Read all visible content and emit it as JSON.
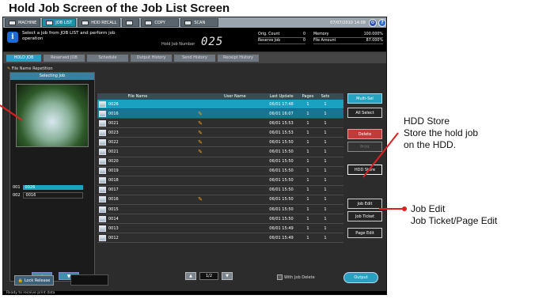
{
  "heading": "Hold Job Screen of the Job List Screen",
  "tabs": [
    {
      "label": "MACHINE",
      "active": false
    },
    {
      "label": "JOB LIST",
      "active": true
    },
    {
      "label": "HDD RECALL",
      "active": false
    },
    {
      "label": "",
      "active": false
    },
    {
      "label": "COPY",
      "active": false
    },
    {
      "label": "SCAN",
      "active": false
    }
  ],
  "datetime": "07/07/2010 14:08",
  "info": {
    "message": "Select a job from JOB LIST and perform job operation",
    "hold_label": "Hold Job Number",
    "hold_number": "025",
    "stats_left": [
      {
        "k": "Orig. Count",
        "v": "0"
      },
      {
        "k": "Reserve Job",
        "v": "0"
      }
    ],
    "stats_right": [
      {
        "k": "Memory",
        "v": "100.000%"
      },
      {
        "k": "File Amount",
        "v": "87.000%"
      }
    ]
  },
  "subtabs": [
    "HOLD JOB",
    "Reserved JOB",
    "Schedule",
    "Output History",
    "Send History",
    "Receipt History"
  ],
  "file_name_repetition": "File Name Repetition",
  "left_panel": {
    "header": "Selecting Job",
    "selected": [
      {
        "no": "001",
        "name": "0026"
      },
      {
        "no": "002",
        "name": "0016"
      }
    ]
  },
  "table": {
    "headers": {
      "file_name": "File Name",
      "user_name": "User Name",
      "last_update": "Last Update",
      "pages": "Pages",
      "sets": "Sets"
    },
    "rows": [
      {
        "name": "0026",
        "edit": "",
        "date": "06/01 17:48",
        "pages": "1",
        "sets": "1",
        "state": "sel"
      },
      {
        "name": "0016",
        "edit": "✎",
        "date": "06/01 16:07",
        "pages": "1",
        "sets": "1",
        "state": "sel2"
      },
      {
        "name": "0021",
        "edit": "✎",
        "date": "06/01 15:53",
        "pages": "1",
        "sets": "1",
        "state": ""
      },
      {
        "name": "0023",
        "edit": "✎",
        "date": "06/01 15:53",
        "pages": "1",
        "sets": "1",
        "state": ""
      },
      {
        "name": "0022",
        "edit": "✎",
        "date": "06/01 15:50",
        "pages": "1",
        "sets": "1",
        "state": ""
      },
      {
        "name": "0021",
        "edit": "✎",
        "date": "06/01 15:50",
        "pages": "1",
        "sets": "1",
        "state": ""
      },
      {
        "name": "0020",
        "edit": "",
        "date": "06/01 15:50",
        "pages": "1",
        "sets": "1",
        "state": ""
      },
      {
        "name": "0019",
        "edit": "",
        "date": "06/01 15:50",
        "pages": "1",
        "sets": "1",
        "state": ""
      },
      {
        "name": "0018",
        "edit": "",
        "date": "06/01 15:50",
        "pages": "1",
        "sets": "1",
        "state": ""
      },
      {
        "name": "0017",
        "edit": "",
        "date": "06/01 15:50",
        "pages": "1",
        "sets": "1",
        "state": ""
      },
      {
        "name": "0016",
        "edit": "✎",
        "date": "06/01 15:50",
        "pages": "1",
        "sets": "1",
        "state": ""
      },
      {
        "name": "0015",
        "edit": "",
        "date": "06/01 15:50",
        "pages": "1",
        "sets": "1",
        "state": ""
      },
      {
        "name": "0014",
        "edit": "",
        "date": "06/01 15:50",
        "pages": "1",
        "sets": "1",
        "state": ""
      },
      {
        "name": "0013",
        "edit": "",
        "date": "06/01 15:49",
        "pages": "1",
        "sets": "1",
        "state": ""
      },
      {
        "name": "0012",
        "edit": "",
        "date": "06/01 15:49",
        "pages": "1",
        "sets": "1",
        "state": ""
      }
    ]
  },
  "right_buttons": {
    "multi_sel": "Multi-Sel",
    "all_select": "All Select",
    "delete": "Delete",
    "print": "Print",
    "hdd_store": "HDD Store",
    "job_edit": "Job Edit",
    "job_ticket": "Job Ticket",
    "page_edit": "Page Edit"
  },
  "bottom": {
    "lock_release": "Lock Release",
    "page": "1/2",
    "with_job_delete": "With Job Delete",
    "output": "Output",
    "status": "Ready to receive print data"
  },
  "annotations": {
    "hdd_store_title": "HDD Store",
    "hdd_store_desc1": "Store the hold job",
    "hdd_store_desc2": "on the HDD.",
    "job_edit_title": "Job Edit",
    "job_edit_desc": "Job Ticket/Page Edit"
  },
  "colors": {
    "accent": "#1aa0c0",
    "annotation_line": "#e02020"
  }
}
